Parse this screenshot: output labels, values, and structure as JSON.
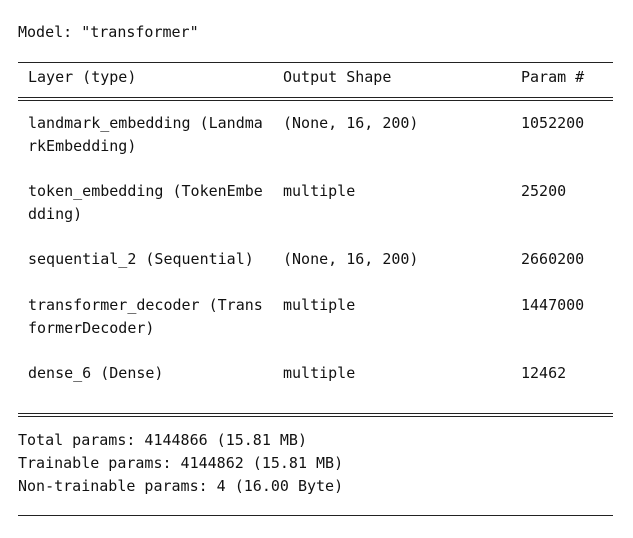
{
  "model_title": "Model: \"transformer\"",
  "headers": {
    "layer": "Layer (type)",
    "output_shape": "Output Shape",
    "params": "Param #"
  },
  "rows": [
    {
      "layer_line1": "landmark_embedding (Landma",
      "layer_line2": "rkEmbedding)",
      "output_shape": "(None, 16, 200)",
      "params": "1052200"
    },
    {
      "layer_line1": "token_embedding (TokenEmbe",
      "layer_line2": "dding)",
      "output_shape": "multiple",
      "params": "25200"
    },
    {
      "layer_line1": "sequential_2 (Sequential)",
      "layer_line2": "",
      "output_shape": "(None, 16, 200)",
      "params": "2660200"
    },
    {
      "layer_line1": "transformer_decoder (Trans",
      "layer_line2": "formerDecoder)",
      "output_shape": "multiple",
      "params": "1447000"
    },
    {
      "layer_line1": "dense_6 (Dense)",
      "layer_line2": "",
      "output_shape": "multiple",
      "params": "12462"
    }
  ],
  "totals": {
    "total": "Total params: 4144866 (15.81 MB)",
    "trainable": "Trainable params: 4144862 (15.81 MB)",
    "non_trainable": "Non-trainable params: 4 (16.00 Byte)"
  }
}
